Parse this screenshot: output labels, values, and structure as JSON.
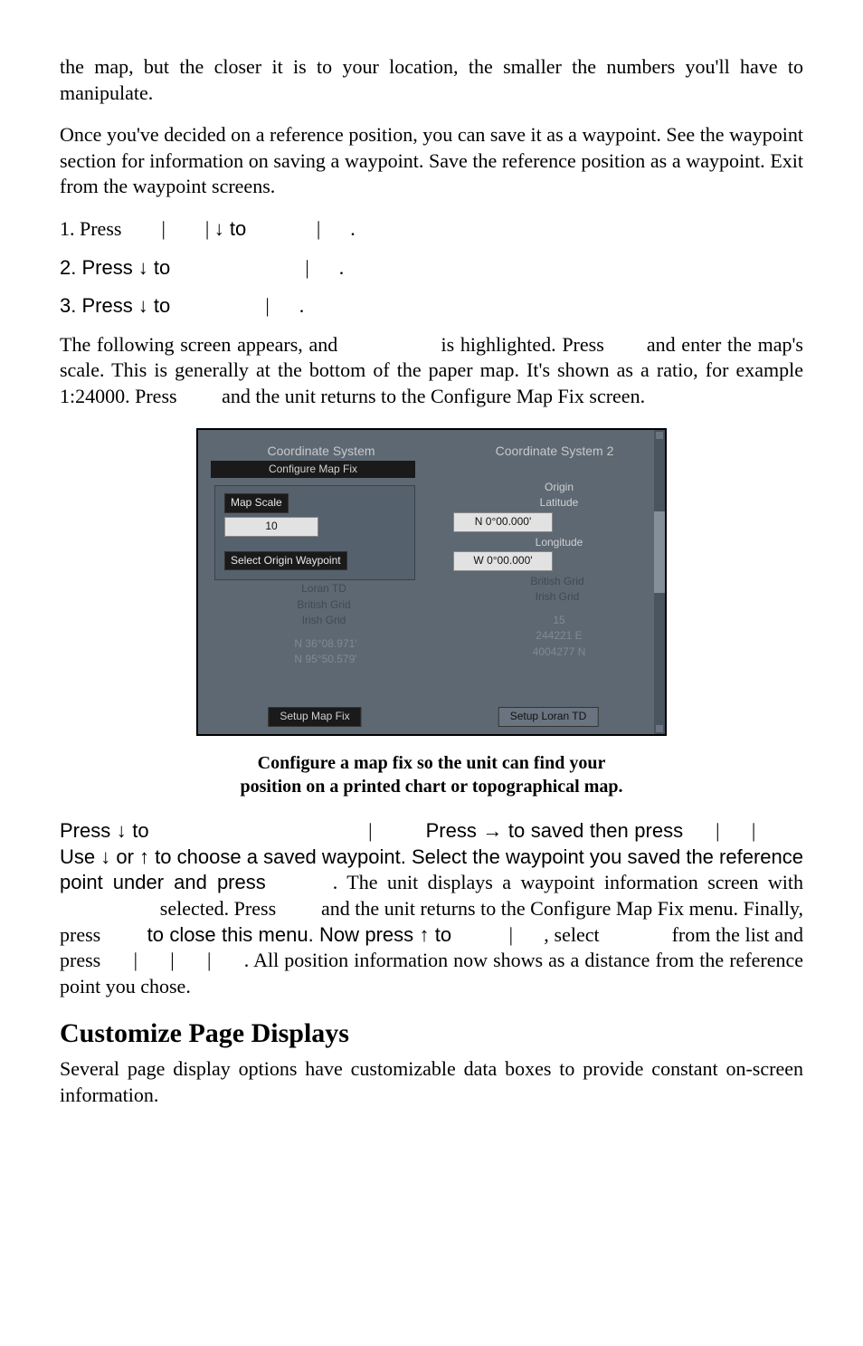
{
  "para1": "the map, but the closer it is to your location, the smaller the numbers you'll have to manipulate.",
  "para2": "Once you've decided on a reference position, you can save it as a waypoint. See the waypoint section for information on saving a waypoint. Save the reference position as a waypoint. Exit from the waypoint screens.",
  "steps": {
    "s1a": "1. Press ",
    "pipe": "|",
    "s1b": "↓ to ",
    "period": ".",
    "s2a": "2. Press ↓ to ",
    "s3a": "3. Press ↓ to "
  },
  "para3a": "The following screen appears, and ",
  "para3b": " is highlighted. Press ",
  "para3c": " and enter the map's scale. This is generally at the bottom of the paper map. It's shown as a ratio, for example 1:24000. Press ",
  "para3d": " and the unit returns to the Configure Map Fix screen.",
  "figure": {
    "col1_header": "Coordinate System",
    "col1_sub": "Configure Map Fix",
    "map_scale_label": "Map Scale",
    "map_scale_value": "10",
    "select_origin_label": "Select Origin Waypoint",
    "ghost1": "Loran TD",
    "ghost2": "British Grid",
    "ghost3": "Irish Grid",
    "ghost_coord1": "N  36°08.971'",
    "ghost_coord2": "N  95°50.579'",
    "setup_map_fix": "Setup Map Fix",
    "col2_header": "Coordinate System 2",
    "origin_label": "Origin",
    "lat_label": "Latitude",
    "lat_val": "N    0°00.000'",
    "lon_label": "Longitude",
    "lon_val": "W    0°00.000'",
    "ghost_r1": "British Grid",
    "ghost_r2": "Irish Grid",
    "ghost_r3": "15",
    "ghost_r4": "244221 E",
    "ghost_r5": "4004277 N",
    "setup_loran": "Setup Loran TD"
  },
  "caption1": "Configure a map fix so the unit can find your",
  "caption2": "position on a printed chart or topographical map.",
  "para4": {
    "a": "Press ↓ to ",
    "b": "Press → to saved then press ",
    "c": "Use ↓ or ↑ to choose a saved waypoint. Select the waypoint you saved the reference point under and press ",
    "d": ". The unit displays a waypoint information screen with ",
    "e": " selected. Press ",
    "f": " and the unit returns to the Configure Map Fix menu. Finally, press ",
    "g": " to close this menu. Now press ↑ to ",
    "h": ", select ",
    "i": " from the list and press ",
    "j": ". All position information now shows as a distance from the reference point you chose."
  },
  "heading": "Customize Page Displays",
  "para5": "Several page display options have customizable data boxes to provide constant on-screen information."
}
